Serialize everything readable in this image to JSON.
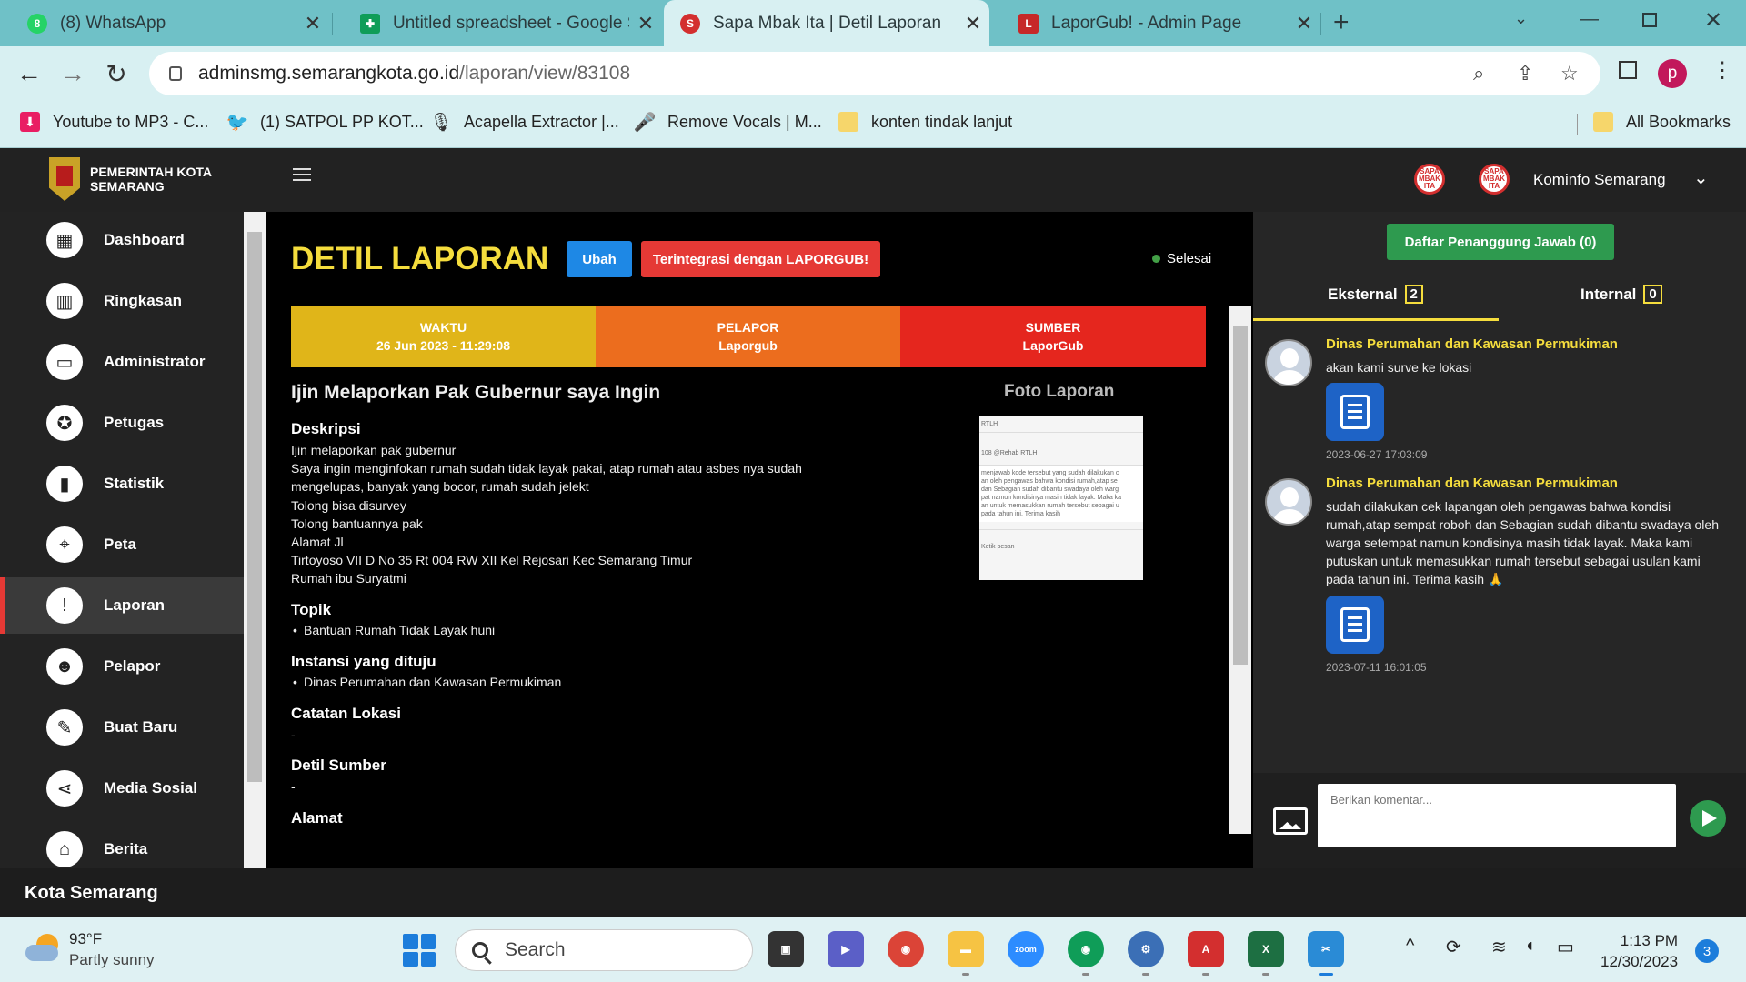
{
  "browser": {
    "tabs": [
      {
        "title": "(8) WhatsApp",
        "icon": "whatsapp-icon",
        "color": "#25d366"
      },
      {
        "title": "Untitled spreadsheet - Google S",
        "icon": "sheets-icon",
        "color": "#0f9d58"
      },
      {
        "title": "Sapa Mbak Ita | Detil Laporan",
        "icon": "sapa-mbak-ita-icon",
        "color": "#d32f2f"
      },
      {
        "title": "LaporGub! - Admin Page",
        "icon": "laporgub-icon",
        "color": "#c62828"
      }
    ],
    "url_host": "adminsmg.semarangkota.go.id",
    "url_path": "/laporan/view/83108",
    "profile_initial": "p",
    "bookmarks": [
      {
        "label": "Youtube to MP3 - C...",
        "icon": "download-icon",
        "color": "#e91e63"
      },
      {
        "label": "(1) SATPOL PP KOT...",
        "icon": "twitter-icon",
        "color": "#1da1f2"
      },
      {
        "label": "Acapella Extractor |...",
        "icon": "microphone-icon",
        "color": "#333333"
      },
      {
        "label": "Remove Vocals | M...",
        "icon": "microphone-icon",
        "color": "#333333"
      },
      {
        "label": "konten tindak lanjut",
        "icon": "folder-icon",
        "color": "#f6d66b"
      }
    ],
    "all_bookmarks": "All Bookmarks"
  },
  "app": {
    "org_line1": "PEMERINTAH KOTA",
    "org_line2": "SEMARANG",
    "user": "Kominfo Semarang",
    "logo_text": "SAPA MBAK ITA"
  },
  "sidebar": {
    "items": [
      {
        "label": "Dashboard",
        "icon": "dashboard-icon",
        "glyph": "▦"
      },
      {
        "label": "Ringkasan",
        "icon": "summary-chart-icon",
        "glyph": "▥"
      },
      {
        "label": "Administrator",
        "icon": "monitor-icon",
        "glyph": "▭"
      },
      {
        "label": "Petugas",
        "icon": "badge-icon",
        "glyph": "✪"
      },
      {
        "label": "Statistik",
        "icon": "bar-chart-icon",
        "glyph": "▮"
      },
      {
        "label": "Peta",
        "icon": "map-pin-icon",
        "glyph": "⌖"
      },
      {
        "label": "Laporan",
        "icon": "report-alert-icon",
        "glyph": "!"
      },
      {
        "label": "Pelapor",
        "icon": "users-icon",
        "glyph": "☻"
      },
      {
        "label": "Buat Baru",
        "icon": "pencil-icon",
        "glyph": "✎"
      },
      {
        "label": "Media Sosial",
        "icon": "share-icon",
        "glyph": "⋖"
      },
      {
        "label": "Berita",
        "icon": "building-icon",
        "glyph": "⌂"
      }
    ],
    "active": "Laporan"
  },
  "footer": "Kota Semarang",
  "report": {
    "heading": "DETIL LAPORAN",
    "edit_label": "Ubah",
    "integrated_label": "Terintegrasi dengan LAPORGUB!",
    "status": "Selesai",
    "waktu_label": "WAKTU",
    "waktu_value": "26 Jun 2023 - 11:29:08",
    "pelapor_label": "PELAPOR",
    "pelapor_value": "Laporgub",
    "sumber_label": "SUMBER",
    "sumber_value": "LaporGub",
    "title": "Ijin Melaporkan Pak Gubernur saya Ingin",
    "deskripsi_label": "Deskripsi",
    "deskripsi_lines": [
      "Ijin melaporkan pak gubernur",
      "Saya ingin menginfokan rumah sudah tidak layak pakai, atap rumah atau asbes nya sudah",
      "mengelupas, banyak yang bocor, rumah sudah jelekt",
      "Tolong bisa disurvey",
      "Tolong bantuannya pak",
      "Alamat Jl",
      "Tirtoyoso VII D No 35 Rt 004 RW XII Kel Rejosari Kec Semarang Timur",
      "Rumah ibu Suryatmi"
    ],
    "topik_label": "Topik",
    "topik": "Bantuan Rumah Tidak Layak huni",
    "instansi_label": "Instansi yang dituju",
    "instansi": "Dinas Perumahan dan Kawasan Permukiman",
    "catatan_label": "Catatan Lokasi",
    "catatan": "-",
    "detil_sumber_label": "Detil Sumber",
    "detil_sumber": "-",
    "alamat_label": "Alamat",
    "foto_label": "Foto Laporan",
    "foto_snippet": {
      "l1": "RTLH",
      "l2": "108 @Rehab RTLH",
      "l3": "menjawab kode tersebut yang sudah dilakukan c",
      "l4": "an oleh pengawas bahwa kondisi rumah,atap se",
      "l5": "dan Sebagian sudah dibantu swadaya oleh warg",
      "l6": "pat namun kondisinya masih tidak layak. Maka ka",
      "l7": "an untuk memasukkan rumah tersebut sebagai u",
      "l8": "pada tahun ini. Terima kasih",
      "l9": "Ketik pesan"
    },
    "colors": {
      "waktu": "#e0b519",
      "pelapor": "#ec6d1e",
      "sumber": "#e5261e",
      "heading": "#f5dd3d"
    }
  },
  "responders": {
    "button_label": "Daftar Penanggung Jawab (0)",
    "tab_external": "Eksternal",
    "tab_external_count": "2",
    "tab_internal": "Internal",
    "tab_internal_count": "0",
    "comments": [
      {
        "name": "Dinas Perumahan dan Kawasan Permukiman",
        "text": "akan kami surve ke lokasi",
        "time": "2023-06-27 17:03:09"
      },
      {
        "name": "Dinas Perumahan dan Kawasan Permukiman",
        "text": "sudah dilakukan cek lapangan oleh pengawas bahwa kondisi rumah,atap sempat roboh dan Sebagian sudah dibantu swadaya oleh warga setempat namun kondisinya masih tidak layak. Maka kami putuskan untuk memasukkan rumah tersebut sebagai usulan kami pada tahun ini. Terima kasih 🙏",
        "time": "2023-07-11 16:01:05"
      }
    ],
    "comment_placeholder": "Berikan komentar..."
  },
  "taskbar": {
    "temp": "93°F",
    "weather": "Partly sunny",
    "search": "Search",
    "time": "1:13 PM",
    "date": "12/30/2023",
    "notifications": "3",
    "apps": [
      {
        "name": "task-view-icon",
        "color": "#333333",
        "glyph": "▣"
      },
      {
        "name": "teams-icon",
        "color": "#5b5fc7",
        "glyph": "▶"
      },
      {
        "name": "chrome-icon",
        "color": "#db4437",
        "glyph": "◉"
      },
      {
        "name": "file-explorer-icon",
        "color": "#f6c343",
        "glyph": "▬"
      },
      {
        "name": "zoom-icon",
        "color": "#2d8cff",
        "glyph": "zoom"
      },
      {
        "name": "chrome-profile-icon",
        "color": "#0f9d58",
        "glyph": "◉"
      },
      {
        "name": "settings-gear-icon",
        "color": "#3b6fb6",
        "glyph": "⚙"
      },
      {
        "name": "acrobat-icon",
        "color": "#d32f2f",
        "glyph": "A"
      },
      {
        "name": "excel-icon",
        "color": "#1d6f42",
        "glyph": "X"
      },
      {
        "name": "snipping-tool-icon",
        "color": "#2a8bd6",
        "glyph": "✂"
      }
    ]
  }
}
